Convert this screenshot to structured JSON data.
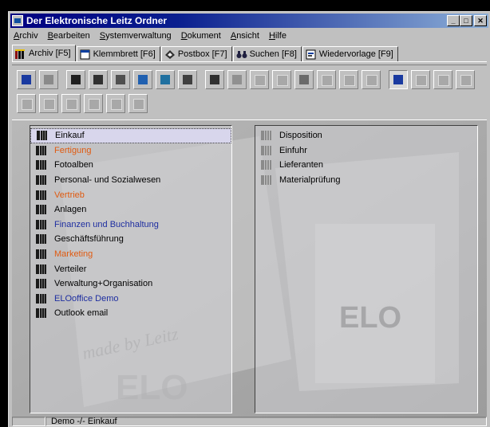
{
  "window": {
    "title": "Der Elektronische Leitz Ordner",
    "minimize": "_",
    "maximize": "□",
    "close": "✕"
  },
  "menu": [
    "Archiv",
    "Bearbeiten",
    "Systemverwaltung",
    "Dokument",
    "Ansicht",
    "Hilfe"
  ],
  "tabs": [
    {
      "label": "Archiv [F5]",
      "icon": "archive-icon",
      "active": true
    },
    {
      "label": "Klemmbrett [F6]",
      "icon": "clipboard-icon"
    },
    {
      "label": "Postbox [F7]",
      "icon": "postbox-icon"
    },
    {
      "label": "Suchen [F8]",
      "icon": "binoculars-icon"
    },
    {
      "label": "Wiedervorlage [F9]",
      "icon": "calendar-icon"
    }
  ],
  "left_list": [
    {
      "label": "Einkauf",
      "style": "selected"
    },
    {
      "label": "Fertigung",
      "style": "orange"
    },
    {
      "label": "Fotoalben",
      "style": "normal"
    },
    {
      "label": "Personal- und Sozialwesen",
      "style": "normal"
    },
    {
      "label": "Vertrieb",
      "style": "orange"
    },
    {
      "label": "Anlagen",
      "style": "normal"
    },
    {
      "label": "Finanzen und Buchhaltung",
      "style": "blue"
    },
    {
      "label": "Geschäftsführung",
      "style": "normal"
    },
    {
      "label": "Marketing",
      "style": "orange"
    },
    {
      "label": "Verteiler",
      "style": "normal"
    },
    {
      "label": "Verwaltung+Organisation",
      "style": "normal"
    },
    {
      "label": "ELOoffice Demo",
      "style": "blue"
    },
    {
      "label": "Outlook email",
      "style": "normal"
    }
  ],
  "right_list": [
    {
      "label": "Disposition"
    },
    {
      "label": "Einfuhr"
    },
    {
      "label": "Lieferanten"
    },
    {
      "label": "Materialprüfung"
    }
  ],
  "watermark": {
    "logo": "ELO",
    "tagline": "made by Leitz"
  },
  "status": {
    "text": "Demo -/- Einkauf"
  },
  "colors": {
    "accent_orange": "#e05a10",
    "accent_blue": "#1e2ea0",
    "title_bar": "#000080"
  }
}
